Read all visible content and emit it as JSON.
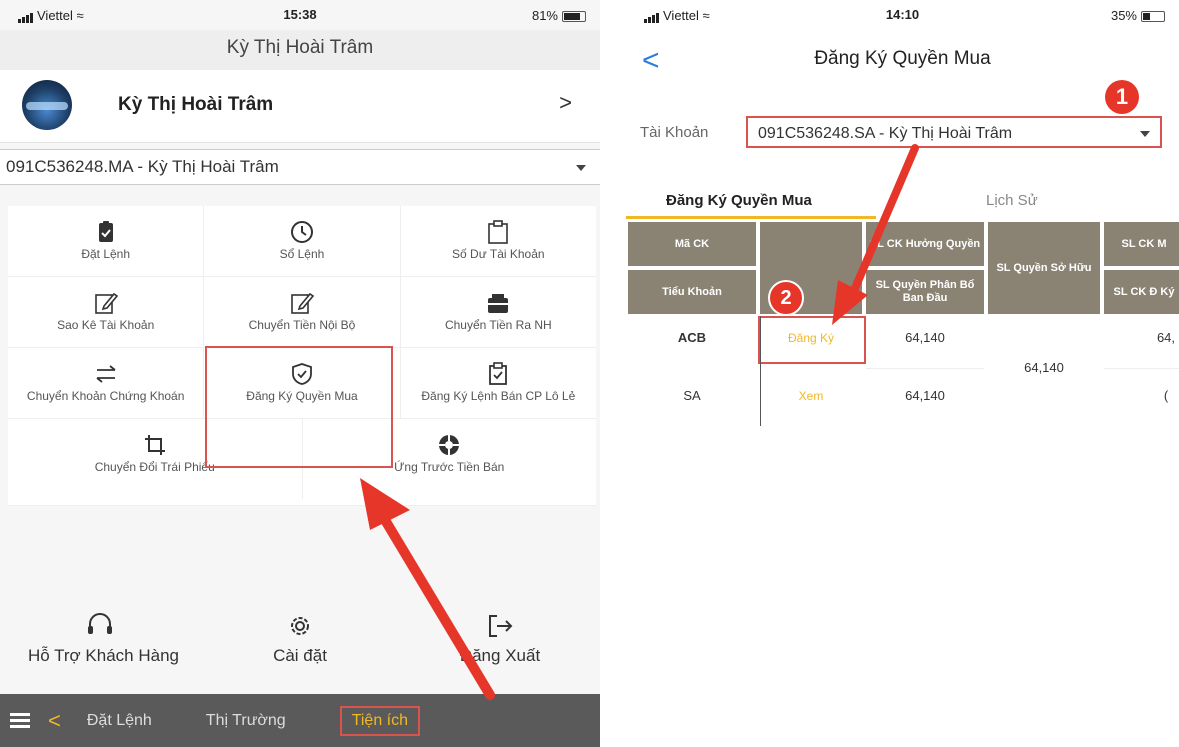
{
  "left_screen": {
    "status": {
      "carrier": "Viettel",
      "time": "15:38",
      "battery": "81%"
    },
    "title": "Kỳ Thị Hoài Trâm",
    "profile": {
      "name": "Kỳ Thị Hoài Trâm",
      "chevron": ">"
    },
    "account_select": "091C536248.MA - Kỳ Thị Hoài Trâm",
    "menu": [
      [
        {
          "label": "Đặt Lệnh",
          "icon": "clipboard-check-icon"
        },
        {
          "label": "Sổ Lệnh",
          "icon": "clock-icon"
        },
        {
          "label": "Số Dư Tài Khoản",
          "icon": "clipboard-icon"
        }
      ],
      [
        {
          "label": "Sao Kê Tài Khoản",
          "icon": "edit-icon"
        },
        {
          "label": "Chuyển Tiền Nội Bộ",
          "icon": "edit-icon"
        },
        {
          "label": "Chuyển Tiền Ra NH",
          "icon": "wallet-icon"
        }
      ],
      [
        {
          "label": "Chuyển Khoản Chứng Khoán",
          "icon": "swap-icon"
        },
        {
          "label": "Đăng Ký Quyền Mua",
          "icon": "shield-check-icon"
        },
        {
          "label": "Đăng Ký Lệnh Bán CP Lô Lẻ",
          "icon": "clipboard-check-icon"
        }
      ],
      [
        {
          "label": "Chuyển Đổi Trái Phiếu",
          "icon": "crop-icon"
        },
        {
          "label": "Ứng Trước Tiền Bán",
          "icon": "lifebuoy-icon"
        }
      ]
    ],
    "bottom_actions": [
      {
        "label": "Hỗ Trợ Khách Hàng",
        "icon": "headset-icon"
      },
      {
        "label": "Cài đặt",
        "icon": "gear-icon"
      },
      {
        "label": "Đăng Xuất",
        "icon": "logout-icon"
      }
    ],
    "tabbar": {
      "back": "<",
      "tabs": [
        "Đặt Lệnh",
        "Thị Trường",
        "Tiện ích"
      ],
      "active": "Tiện ích"
    }
  },
  "right_screen": {
    "status": {
      "carrier": "Viettel",
      "time": "14:10",
      "battery": "35%"
    },
    "title": "Đăng Ký Quyền Mua",
    "back": "<",
    "account_label": "Tài Khoản",
    "account_value": "091C536248.SA - Kỳ Thị Hoài Trâm",
    "tabs": [
      "Đăng Ký Quyền Mua",
      "Lịch Sử"
    ],
    "table": {
      "headers": {
        "ma_ck": "Mã CK",
        "tieu_khoan": "Tiểu Khoản",
        "sl_ck_huong_quyen": "SL CK Hưởng Quyền",
        "sl_quyen_phan_bo": "SL Quyền Phân Bổ Ban Đầu",
        "sl_quyen_so_huu": "SL Quyền Sở Hữu",
        "sl_ck_m": "SL CK M",
        "sl_ck_ky": "SL CK Đ Ký"
      },
      "rows": [
        {
          "code": "ACB",
          "action": "Đăng Ký",
          "value": "64,140",
          "last": "64,"
        },
        {
          "code": "SA",
          "action": "Xem",
          "value": "64,140",
          "last": "("
        }
      ],
      "merged_value": "64,140"
    },
    "annotations": [
      "1",
      "2"
    ]
  },
  "colors": {
    "accent": "#f1b826",
    "highlight": "#d9534f",
    "badge": "#e6362a",
    "header": "#8a8373",
    "ios_blue": "#2a7de1"
  }
}
